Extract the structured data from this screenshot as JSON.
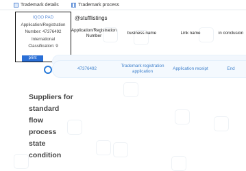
{
  "tabs": {
    "details": "Trademark details",
    "process": "Trademark process"
  },
  "card": {
    "name": "IQOO PAD",
    "reg_number_line1": "Application/Registration",
    "reg_number_line2": "Number: 47376492",
    "classification_line1": "International",
    "classification_line2": "Classification: 9",
    "print_label": "print"
  },
  "store_name": "@stufflistings",
  "table": {
    "headers": {
      "reg_line1": "Application/Registration",
      "reg_line2": "Number",
      "business": "business name",
      "link": "Link name",
      "conclusion": "in conclusion"
    },
    "row": {
      "number": "47376492",
      "business_line1": "Trademark registration",
      "business_line2": "application",
      "link": "Application receipt",
      "conclusion": "End"
    }
  },
  "side_title": [
    "Suppliers for",
    "standard",
    "flow",
    "process",
    "state",
    "condition"
  ]
}
